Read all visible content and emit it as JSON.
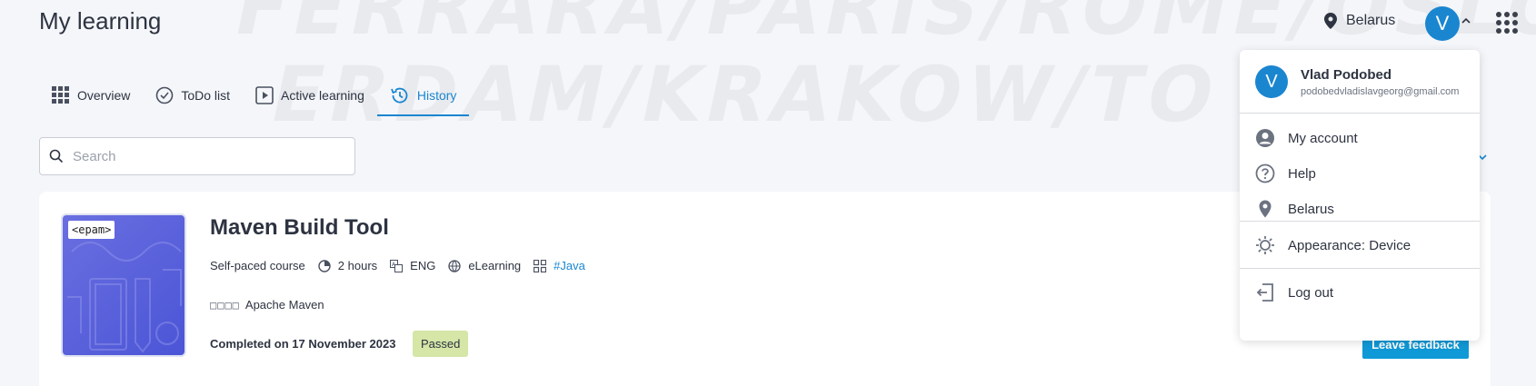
{
  "page": {
    "title": "My learning"
  },
  "watermark": {
    "line1": "FERRARA/PARIS/ROME/OSLO/FL",
    "line2": "ERDAM/KRAKOW/TO"
  },
  "header": {
    "location": "Belarus",
    "avatar_letter": "V"
  },
  "tabs": [
    {
      "label": "Overview",
      "icon": "grid-icon"
    },
    {
      "label": "ToDo list",
      "icon": "check-circle-icon"
    },
    {
      "label": "Active learning",
      "icon": "play-icon"
    },
    {
      "label": "History",
      "icon": "history-icon",
      "active": true
    }
  ],
  "search": {
    "placeholder": "Search",
    "value": ""
  },
  "course": {
    "title": "Maven Build Tool",
    "badge": "<epam>",
    "type": "Self-paced course",
    "duration": "2 hours",
    "language": "ENG",
    "format": "eLearning",
    "tag": "#Java",
    "skill_glyph": "□□□□",
    "skill": "Apache Maven",
    "completed": "Completed on 17 November 2023",
    "status": "Passed",
    "feedback_label": "Leave feedback"
  },
  "menu": {
    "avatar_letter": "V",
    "name": "Vlad Podobed",
    "email": "podobedvladislavgeorg@gmail.com",
    "items": [
      {
        "label": "My account",
        "icon": "account-icon"
      },
      {
        "label": "Help",
        "icon": "help-icon"
      },
      {
        "label": "Belarus",
        "icon": "location-icon"
      },
      {
        "label": "Appearance: Device",
        "icon": "sun-icon"
      },
      {
        "label": "Log out",
        "icon": "logout-icon"
      }
    ]
  },
  "colors": {
    "accent": "#1a86d0",
    "button": "#0f99d6",
    "passed_bg": "#d5e6a7",
    "background": "#f4f6fa"
  }
}
